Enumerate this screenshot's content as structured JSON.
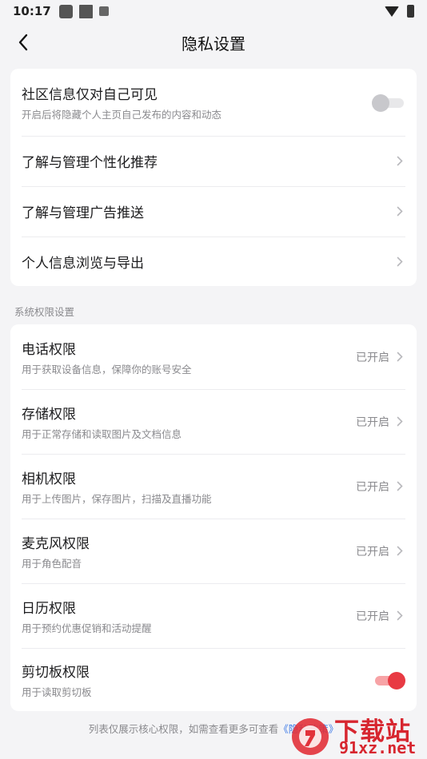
{
  "status_bar": {
    "time": "10:17"
  },
  "header": {
    "title": "隐私设置"
  },
  "privacy_items": [
    {
      "title": "社区信息仅对自己可见",
      "subtitle": "开启后将隐藏个人主页自己发布的内容和动态"
    },
    {
      "title": "了解与管理个性化推荐"
    },
    {
      "title": "了解与管理广告推送"
    },
    {
      "title": "个人信息浏览与导出"
    }
  ],
  "system_section": {
    "label": "系统权限设置"
  },
  "permissions": [
    {
      "title": "电话权限",
      "subtitle": "用于获取设备信息，保障你的账号安全",
      "status": "已开启"
    },
    {
      "title": "存储权限",
      "subtitle": "用于正常存储和读取图片及文档信息",
      "status": "已开启"
    },
    {
      "title": "相机权限",
      "subtitle": "用于上传图片，保存图片，扫描及直播功能",
      "status": "已开启"
    },
    {
      "title": "麦克风权限",
      "subtitle": "用于角色配音",
      "status": "已开启"
    },
    {
      "title": "日历权限",
      "subtitle": "用于预约优惠促销和活动提醒",
      "status": "已开启"
    },
    {
      "title": "剪切板权限",
      "subtitle": "用于读取剪切板"
    }
  ],
  "footer": {
    "text": "列表仅展示核心权限，如需查看更多可查看",
    "link": "《隐私政策》"
  },
  "watermark": {
    "brand": "下载站",
    "url": "91xz.net"
  },
  "colors": {
    "accent_red": "#e83a43",
    "link_blue": "#3b78e7"
  }
}
